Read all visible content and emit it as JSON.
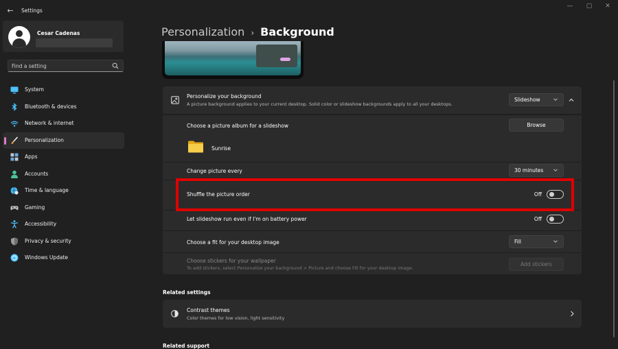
{
  "window": {
    "title": "Settings",
    "back_glyph": "←",
    "minimize_glyph": "—",
    "maximize_glyph": "▢",
    "close_glyph": "✕"
  },
  "user": {
    "name": "Cesar Cadenas",
    "email": ""
  },
  "search": {
    "placeholder": "Find a setting"
  },
  "sidebar": {
    "items": [
      {
        "label": "System",
        "icon": "monitor-icon",
        "color": "#4cc2ff"
      },
      {
        "label": "Bluetooth & devices",
        "icon": "bluetooth-icon",
        "color": "#4cc2ff"
      },
      {
        "label": "Network & internet",
        "icon": "wifi-icon",
        "color": "#4cc2ff"
      },
      {
        "label": "Personalization",
        "icon": "brush-icon",
        "color": "#e8a33d",
        "active": true
      },
      {
        "label": "Apps",
        "icon": "apps-icon",
        "color": "#6fa8dc"
      },
      {
        "label": "Accounts",
        "icon": "person-icon",
        "color": "#49c39e"
      },
      {
        "label": "Time & language",
        "icon": "globe-clock-icon",
        "color": "#4cc2ff"
      },
      {
        "label": "Gaming",
        "icon": "gamepad-icon",
        "color": "#bfbfbf"
      },
      {
        "label": "Accessibility",
        "icon": "accessibility-icon",
        "color": "#4cc2ff"
      },
      {
        "label": "Privacy & security",
        "icon": "shield-icon",
        "color": "#9a9a9a"
      },
      {
        "label": "Windows Update",
        "icon": "update-icon",
        "color": "#4cc2ff"
      }
    ],
    "accent": "#e07ec6"
  },
  "breadcrumb": {
    "parent": "Personalization",
    "separator": "›",
    "current": "Background"
  },
  "background": {
    "title": "Personalize your background",
    "description": "A picture background applies to your current desktop. Solid color or slideshow backgrounds apply to all your desktops.",
    "type_value": "Slideshow",
    "album": {
      "title": "Choose a picture album for a slideshow",
      "button": "Browse",
      "folder": "Sunrise"
    },
    "change_every": {
      "title": "Change picture every",
      "value": "30 minutes"
    },
    "shuffle": {
      "title": "Shuffle the picture order",
      "state_label": "Off"
    },
    "battery": {
      "title": "Let slideshow run even if I'm on battery power",
      "state_label": "Off"
    },
    "fit": {
      "title": "Choose a fit for your desktop image",
      "value": "Fill"
    },
    "stickers": {
      "title": "Choose stickers for your wallpaper",
      "description": "To add stickers, select Personalize your background > Picture and choose Fill for your desktop image.",
      "button": "Add stickers"
    }
  },
  "related_settings": {
    "heading": "Related settings",
    "contrast": {
      "title": "Contrast themes",
      "description": "Color themes for low vision, light sensitivity"
    }
  },
  "related_support": {
    "heading": "Related support"
  },
  "colors": {
    "highlight": "#e00000",
    "background": "#202020",
    "card": "#2b2b2b"
  }
}
